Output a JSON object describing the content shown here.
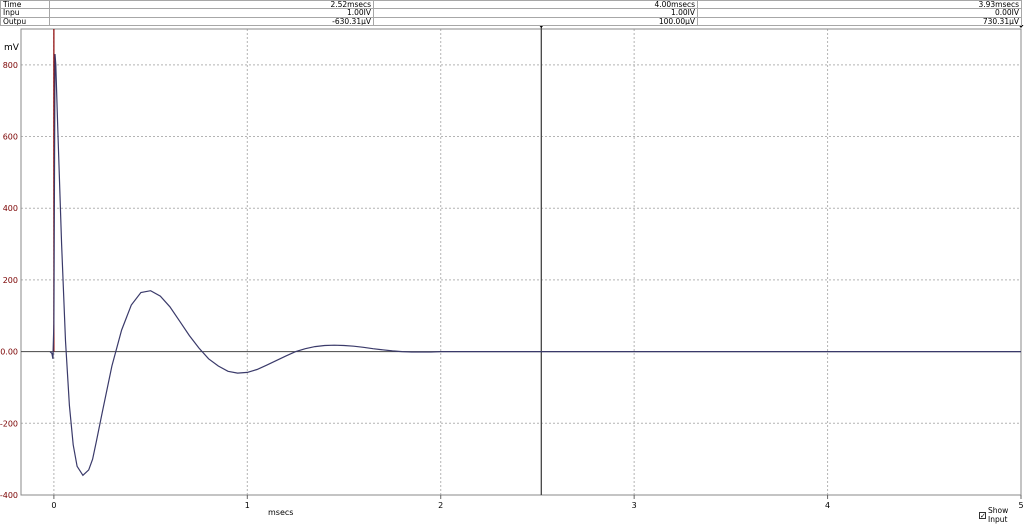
{
  "cursor_table": {
    "rows": [
      {
        "label": "Time",
        "values": [
          "2.52msecs",
          "4.00msecs",
          "3.93msecs"
        ]
      },
      {
        "label": "Inpu",
        "values": [
          "1.00IV",
          "1.00IV",
          "0.00IV"
        ]
      },
      {
        "label": "Outpu",
        "values": [
          "-630.31µV",
          "100.00µV",
          "730.31µV"
        ]
      }
    ]
  },
  "show_input": {
    "label": "Show Input",
    "checked": true
  },
  "colors": {
    "output_trace": "#3a3a6a",
    "input_trace": "#8b0000",
    "grid": "#b4b4b4",
    "ytick_text": "#7a0000",
    "cursor": "#444444"
  },
  "chart_data": {
    "type": "line",
    "ylabel": "mV",
    "xlabel": "msecs",
    "xlim": [
      -0.17,
      5
    ],
    "ylim": [
      -400,
      900
    ],
    "yticks": [
      -400,
      -200,
      0,
      200,
      400,
      600,
      800
    ],
    "ytick_labels": [
      "-400",
      "-200",
      "0.00",
      "200",
      "400",
      "600",
      "800"
    ],
    "xticks": [
      0,
      1,
      2,
      3,
      4,
      5
    ],
    "xtick_labels": [
      "0",
      "1",
      "2",
      "3",
      "4",
      "5"
    ],
    "grid": true,
    "cursor_x": 2.52,
    "series": [
      {
        "x": [
          -0.02,
          -0.01,
          -0.005,
          0,
          0.003,
          0.006,
          0.01,
          0.02,
          0.04,
          0.06,
          0.08,
          0.1,
          0.12,
          0.15,
          0.18,
          0.2,
          0.22,
          0.25,
          0.3,
          0.35,
          0.4,
          0.45,
          0.5,
          0.55,
          0.6,
          0.65,
          0.7,
          0.75,
          0.8,
          0.85,
          0.9,
          0.95,
          1.0,
          1.05,
          1.1,
          1.15,
          1.2,
          1.25,
          1.3,
          1.35,
          1.4,
          1.45,
          1.5,
          1.55,
          1.6,
          1.65,
          1.7,
          1.75,
          1.8,
          1.85,
          1.9,
          1.95,
          2.0,
          2.1,
          2.2,
          2.3,
          2.4,
          2.5,
          2.6,
          2.7,
          2.8,
          2.9,
          3.0,
          4.0,
          5.0
        ],
        "y": [
          0,
          -5,
          -20,
          80,
          500,
          830,
          800,
          620,
          300,
          30,
          -150,
          -260,
          -320,
          -345,
          -330,
          -300,
          -250,
          -170,
          -40,
          60,
          130,
          165,
          170,
          155,
          125,
          85,
          45,
          10,
          -20,
          -40,
          -55,
          -60,
          -58,
          -50,
          -38,
          -25,
          -12,
          0,
          8,
          14,
          17,
          18,
          17,
          15,
          12,
          8,
          5,
          2,
          0,
          -1,
          -1,
          -1,
          0,
          0,
          0,
          0,
          0,
          0,
          0,
          0,
          0,
          0,
          0,
          0,
          0
        ]
      }
    ]
  }
}
